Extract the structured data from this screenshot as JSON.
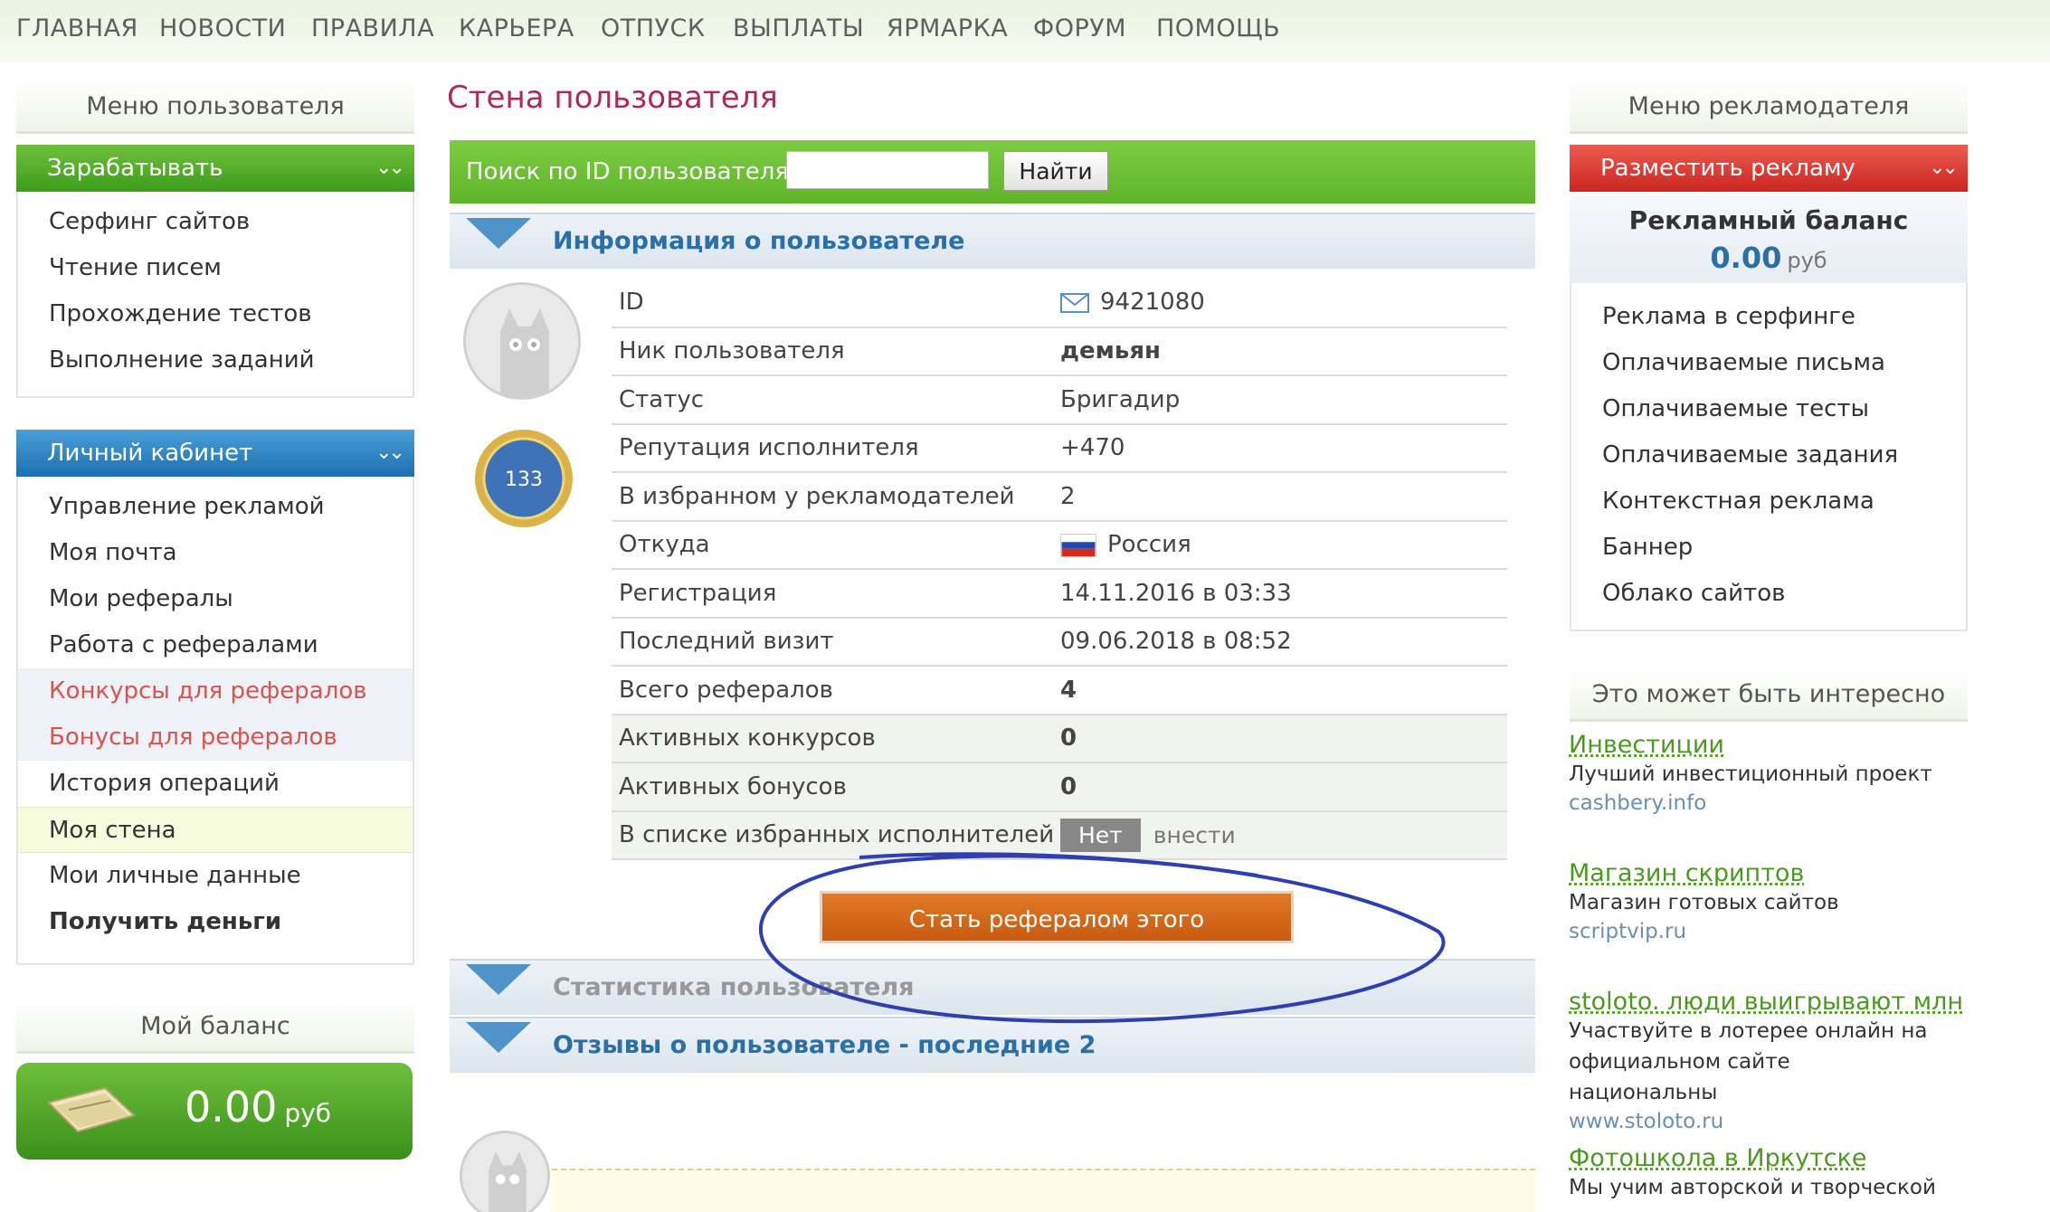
{
  "topnav": [
    "ГЛАВНАЯ",
    "НОВОСТИ",
    "ПРАВИЛА",
    "КАРЬЕРА",
    "ОТПУСК",
    "ВЫПЛАТЫ",
    "ЯРМАРКА",
    "ФОРУМ",
    "ПОМОЩЬ"
  ],
  "left": {
    "header": "Меню пользователя",
    "earn": {
      "title": "Зарабатывать",
      "items": [
        "Серфинг сайтов",
        "Чтение писем",
        "Прохождение тестов",
        "Выполнение заданий"
      ]
    },
    "cabinet": {
      "title": "Личный кабинет",
      "items": [
        "Управление рекламой",
        "Моя почта",
        "Мои рефералы",
        "Работа с рефералами",
        "Конкурсы для рефералов",
        "Бонусы для рефералов",
        "История операций",
        "Моя стена",
        "Мои личные данные",
        "Получить деньги"
      ]
    },
    "balance": {
      "title": "Мой баланс",
      "amount": "0.00",
      "currency": "руб"
    }
  },
  "center": {
    "title": "Стена пользователя",
    "search": {
      "label": "Поиск по ID пользователя:",
      "value": "",
      "button": "Найти"
    },
    "info_title": "Информация о пользователе",
    "medal_number": "133",
    "rows": [
      {
        "key": "ID",
        "value": "9421080"
      },
      {
        "key": "Ник пользователя",
        "value": "демьян"
      },
      {
        "key": "Статус",
        "value": "Бригадир"
      },
      {
        "key": "Репутация исполнителя",
        "value": "+470"
      },
      {
        "key": "В избранном у рекламодателей",
        "value": "2"
      },
      {
        "key": "Откуда",
        "value": "Россия"
      },
      {
        "key": "Регистрация",
        "value": "14.11.2016 в 03:33"
      },
      {
        "key": "Последний визит",
        "value": "09.06.2018 в 08:52"
      },
      {
        "key": "Всего рефералов",
        "value": "4"
      },
      {
        "key": "Активных конкурсов",
        "value": "0"
      },
      {
        "key": "Активных бонусов",
        "value": "0"
      },
      {
        "key": "В списке избранных исполнителей",
        "value": "Нет",
        "action": "внести"
      }
    ],
    "referral_button": "Стать рефералом этого пользователя",
    "stats_title": "Статистика пользователя",
    "reviews_title": "Отзывы о пользователе - последние 2"
  },
  "right": {
    "header": "Меню рекламодателя",
    "place_ad": "Разместить рекламу",
    "ad_balance_title": "Рекламный баланс",
    "ad_balance_value": "0.00",
    "ad_balance_currency": "руб",
    "items": [
      "Реклама в серфинге",
      "Оплачиваемые письма",
      "Оплачиваемые тесты",
      "Оплачиваемые задания",
      "Контекстная реклама",
      "Баннер",
      "Облако сайтов"
    ],
    "interesting_title": "Это может быть интересно",
    "interesting": [
      {
        "title": "Инвестиции",
        "desc": "Лучший инвестиционный проект",
        "url": "cashbery.info"
      },
      {
        "title": "Магазин скриптов",
        "desc": "Магазин готовых сайтов",
        "url": "scriptvip.ru"
      },
      {
        "title": "stoloto. люди выигрывают млн",
        "desc": "Участвуйте в лотерее онлайн на официальном сайте национальны",
        "url": "www.stoloto.ru"
      },
      {
        "title": "Фотошкола в Иркутске",
        "desc": "Мы учим авторской и творческой",
        "url": ""
      }
    ]
  }
}
